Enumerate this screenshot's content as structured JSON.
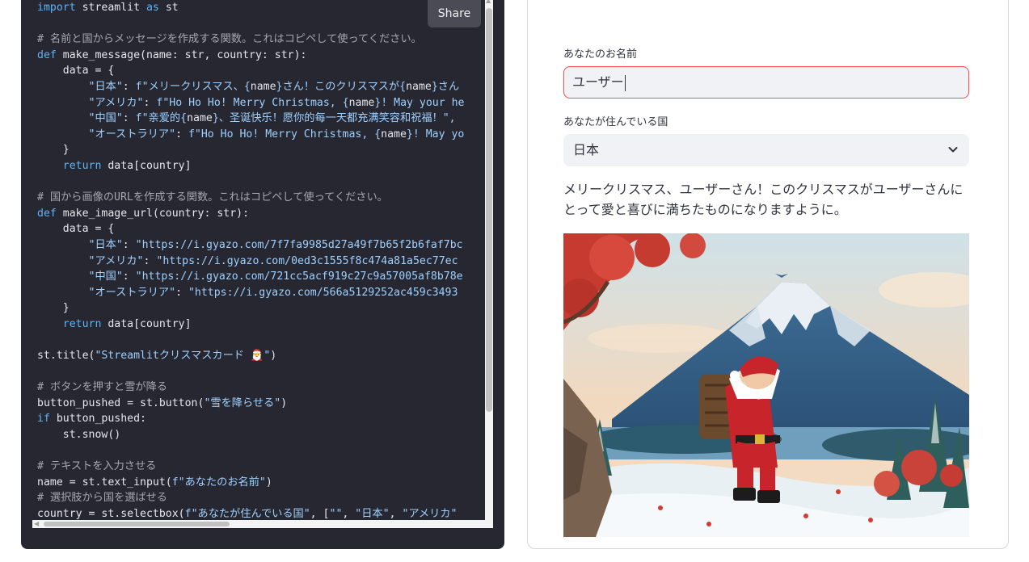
{
  "editor": {
    "share_label": "Share",
    "lines": [
      [
        [
          "kw",
          "import"
        ],
        [
          "pr",
          " streamlit "
        ],
        [
          "kw",
          "as"
        ],
        [
          "pr",
          " st"
        ]
      ],
      [],
      [
        [
          "cm",
          "# 名前と国からメッセージを作成する関数。これはコピペして使ってください。"
        ]
      ],
      [
        [
          "kw",
          "def"
        ],
        [
          "fn",
          " make_message"
        ],
        [
          "pr",
          "(name: str, country: str):"
        ]
      ],
      [
        [
          "pr",
          "    data = {"
        ]
      ],
      [
        [
          "str",
          "        \"日本\""
        ],
        [
          "pr",
          ": "
        ],
        [
          "str",
          "f\"メリークリスマス、{"
        ],
        [
          "pr",
          "name"
        ],
        [
          "str",
          "}さん！このクリスマスが{"
        ],
        [
          "pr",
          "name"
        ],
        [
          "str",
          "}さん"
        ]
      ],
      [
        [
          "str",
          "        \"アメリカ\""
        ],
        [
          "pr",
          ": "
        ],
        [
          "str",
          "f\"Ho Ho Ho! Merry Christmas, {"
        ],
        [
          "pr",
          "name"
        ],
        [
          "str",
          "}! May your he"
        ]
      ],
      [
        [
          "str",
          "        \"中国\""
        ],
        [
          "pr",
          ": "
        ],
        [
          "str",
          "f\"亲爱的{"
        ],
        [
          "pr",
          "name"
        ],
        [
          "str",
          "}、圣诞快乐！愿你的每一天都充满笑容和祝福！\","
        ]
      ],
      [
        [
          "str",
          "        \"オーストラリア\""
        ],
        [
          "pr",
          ": "
        ],
        [
          "str",
          "f\"Ho Ho Ho! Merry Christmas, {"
        ],
        [
          "pr",
          "name"
        ],
        [
          "str",
          "}! May yo"
        ]
      ],
      [
        [
          "pr",
          "    }"
        ]
      ],
      [
        [
          "kw",
          "    return"
        ],
        [
          "pr",
          " data[country]"
        ]
      ],
      [],
      [
        [
          "cm",
          "# 国から画像のURLを作成する関数。これはコピペして使ってください。"
        ]
      ],
      [
        [
          "kw",
          "def"
        ],
        [
          "fn",
          " make_image_url"
        ],
        [
          "pr",
          "(country: str):"
        ]
      ],
      [
        [
          "pr",
          "    data = {"
        ]
      ],
      [
        [
          "str",
          "        \"日本\""
        ],
        [
          "pr",
          ": "
        ],
        [
          "str",
          "\"https://i.gyazo.com/7f7fa9985d27a49f7b65f2b6faf7bc"
        ]
      ],
      [
        [
          "str",
          "        \"アメリカ\""
        ],
        [
          "pr",
          ": "
        ],
        [
          "str",
          "\"https://i.gyazo.com/0ed3c1555f8c474a81a5ec77ec"
        ]
      ],
      [
        [
          "str",
          "        \"中国\""
        ],
        [
          "pr",
          ": "
        ],
        [
          "str",
          "\"https://i.gyazo.com/721cc5acf919c27c9a57005af8b78e"
        ]
      ],
      [
        [
          "str",
          "        \"オーストラリア\""
        ],
        [
          "pr",
          ": "
        ],
        [
          "str",
          "\"https://i.gyazo.com/566a5129252ac459c3493"
        ]
      ],
      [
        [
          "pr",
          "    }"
        ]
      ],
      [
        [
          "kw",
          "    return"
        ],
        [
          "pr",
          " data[country]"
        ]
      ],
      [],
      [
        [
          "pr",
          "st.title("
        ],
        [
          "str",
          "\"Streamlitクリスマスカード 🎅\""
        ],
        [
          "pr",
          ")"
        ]
      ],
      [],
      [
        [
          "cm",
          "# ボタンを押すと雪が降る"
        ]
      ],
      [
        [
          "pr",
          "button_pushed = st.button("
        ],
        [
          "str",
          "\"雪を降らせる\""
        ],
        [
          "pr",
          ")"
        ]
      ],
      [
        [
          "kw",
          "if"
        ],
        [
          "pr",
          " button_pushed:"
        ]
      ],
      [
        [
          "pr",
          "    st.snow()"
        ]
      ],
      [],
      [
        [
          "cm",
          "# テキストを入力させる"
        ]
      ],
      [
        [
          "pr",
          "name = st.text_input("
        ],
        [
          "str",
          "f\"あなたのお名前\""
        ],
        [
          "pr",
          ")"
        ]
      ],
      [
        [
          "cm",
          "# 選択肢から国を選ばせる"
        ]
      ],
      [
        [
          "pr",
          "country = st.selectbox("
        ],
        [
          "str",
          "f\"あなたが住んでいる国\""
        ],
        [
          "pr",
          ", ["
        ],
        [
          "str",
          "\"\""
        ],
        [
          "pr",
          ", "
        ],
        [
          "str",
          "\"日本\""
        ],
        [
          "pr",
          ", "
        ],
        [
          "str",
          "\"アメリカ\""
        ]
      ]
    ]
  },
  "app": {
    "name_label": "あなたのお名前",
    "name_value": "ユーザー",
    "country_label": "あなたが住んでいる国",
    "country_value": "日本",
    "message": "メリークリスマス、ユーザーさん！このクリスマスがユーザーさんにとって愛と喜びに満ちたものになりますように。"
  },
  "colors": {
    "editor_bg": "#262730",
    "keyword": "#5fb4f5",
    "string": "#9fd0ff",
    "comment": "#a6a6b3",
    "input_focus_border": "#ff4b4b",
    "input_bg": "#f0f2f6"
  },
  "icons": {
    "select_chevron": "chevron-down-icon"
  }
}
